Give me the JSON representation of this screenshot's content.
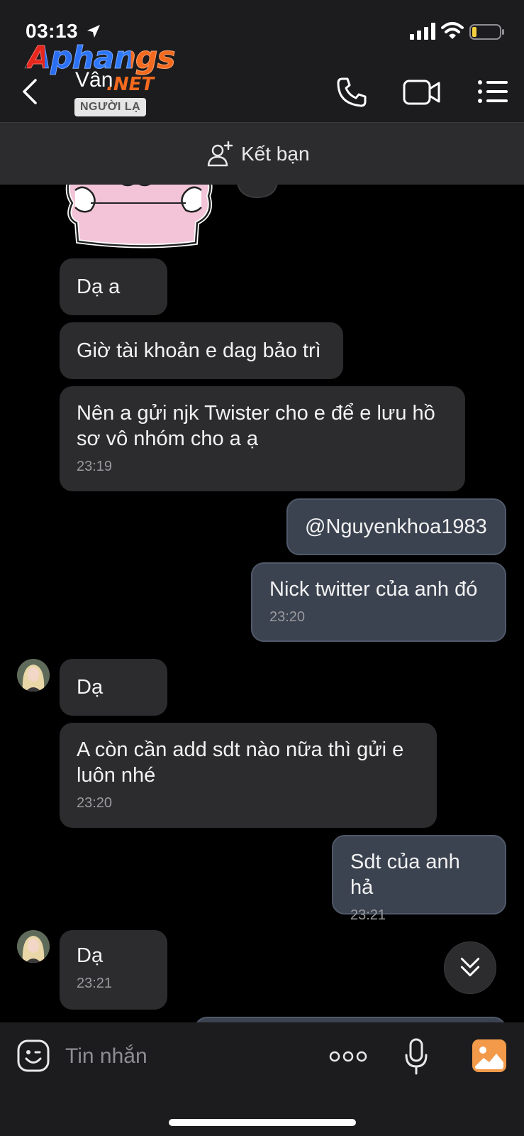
{
  "status_bar": {
    "time": "03:13"
  },
  "watermark": {
    "main": "Aphangs",
    "suffix": ".NET"
  },
  "header": {
    "contact_name": "Vân",
    "stranger_badge": "NGƯỜI LẠ"
  },
  "add_friend": {
    "label": "Kết bạn"
  },
  "messages": [
    {
      "direction": "in",
      "text": "Dạ a",
      "time": ""
    },
    {
      "direction": "in",
      "text": "Giờ tài khoản e dag bảo trì",
      "time": ""
    },
    {
      "direction": "in",
      "text": "Nên a gửi njk Twister cho e để e lưu hồ sơ vô nhóm cho a ạ",
      "time": "23:19"
    },
    {
      "direction": "out",
      "text": "@Nguyenkhoa1983",
      "time": ""
    },
    {
      "direction": "out",
      "text": "Nick twitter của anh đó",
      "time": "23:20"
    },
    {
      "direction": "in",
      "text": "Dạ",
      "time": ""
    },
    {
      "direction": "in",
      "text": "A còn cần add sdt nào nữa thì gửi e luôn nhé",
      "time": "23:20"
    },
    {
      "direction": "out",
      "text": "Sdt của anh hả",
      "time": "23:21"
    },
    {
      "direction": "in",
      "text": "Dạ",
      "time": "23:21"
    }
  ],
  "input": {
    "placeholder": "Tin nhắn"
  },
  "icons": {
    "back": "chevron-left-icon",
    "call": "phone-icon",
    "video": "video-camera-icon",
    "menu": "list-menu-icon",
    "add_friend": "add-user-icon",
    "emoji": "emoji-icon",
    "more": "more-dots-icon",
    "mic": "microphone-icon",
    "image": "image-icon",
    "scroll_down": "double-chevron-down-icon"
  },
  "colors": {
    "header_bg": "#1c1c1e",
    "incoming_bubble": "#2c2c2e",
    "outgoing_bubble": "#3b4250",
    "image_button": "#f2994a"
  }
}
